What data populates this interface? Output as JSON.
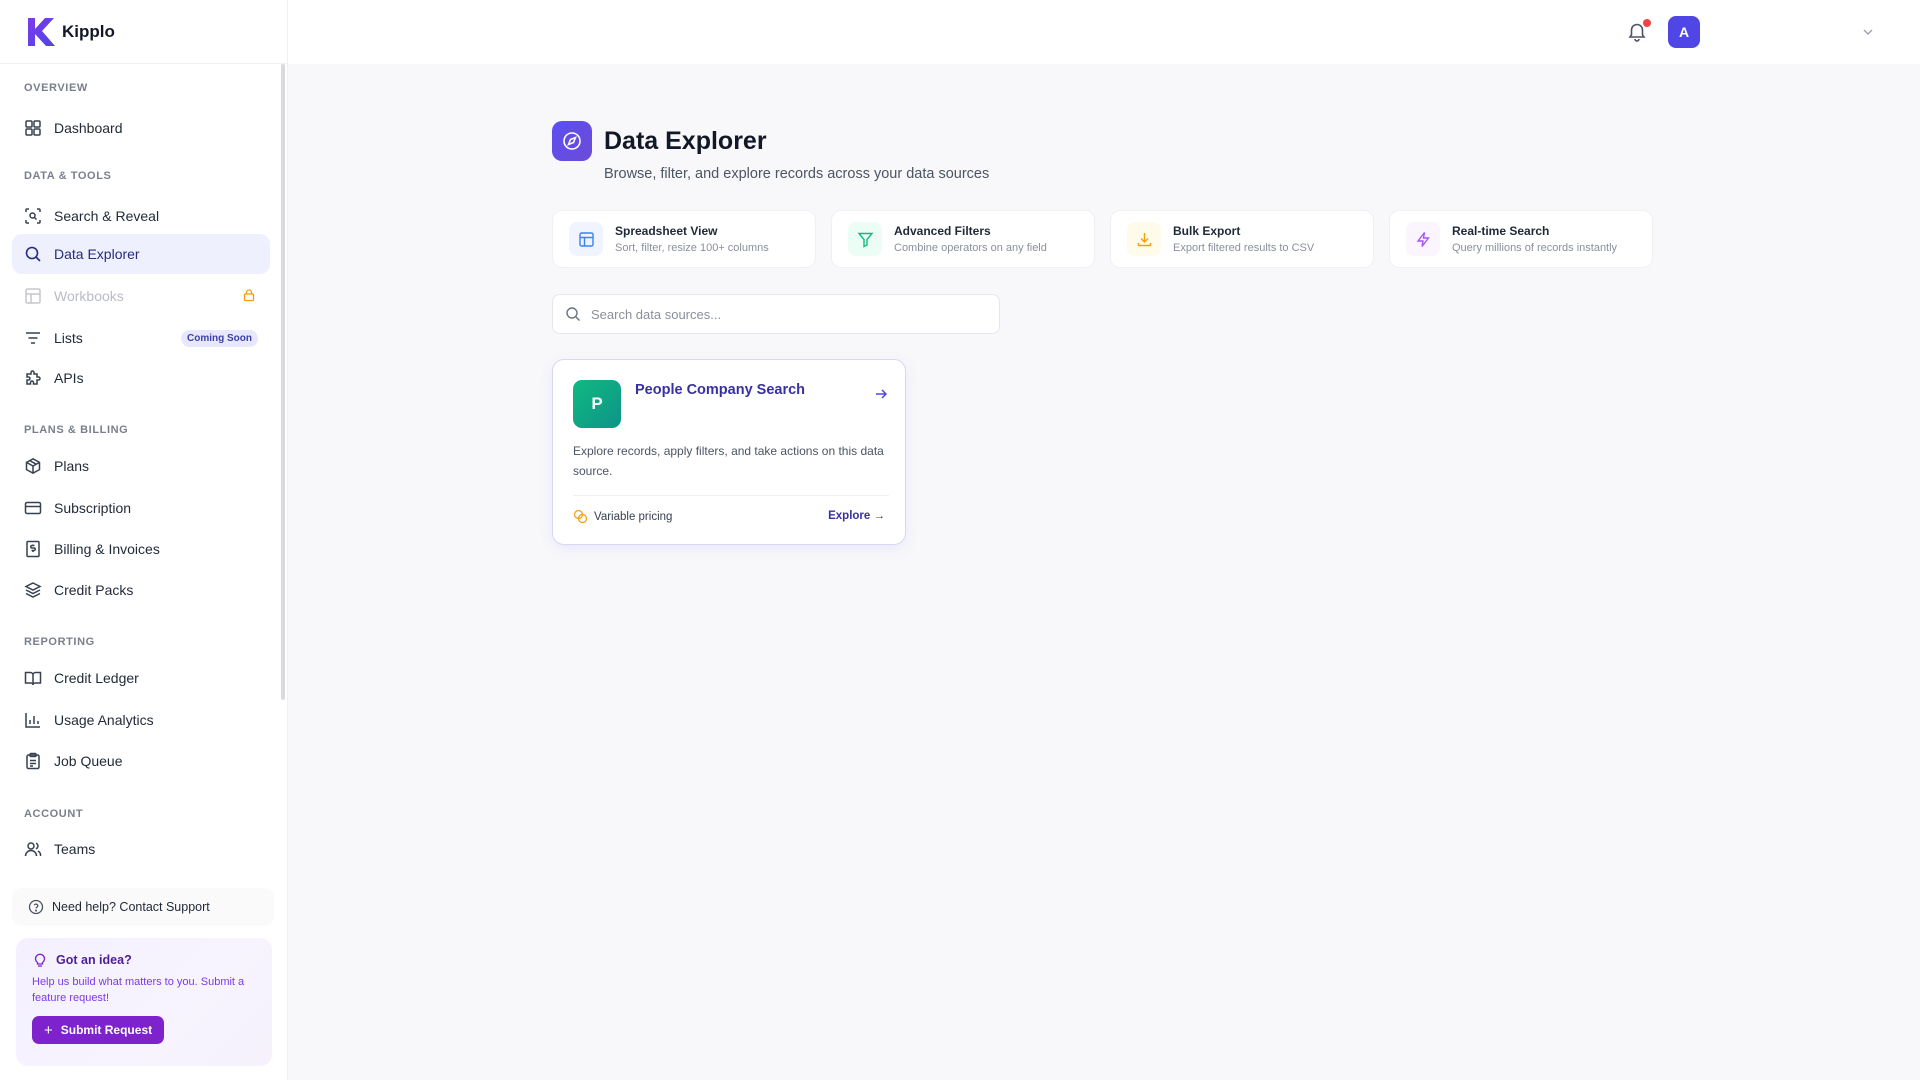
{
  "brand": {
    "name": "Kipplo"
  },
  "sidebar": {
    "sections": {
      "overview": "OVERVIEW",
      "data_tools": "DATA & TOOLS",
      "plans_billing": "PLANS & BILLING",
      "reporting": "REPORTING",
      "account": "ACCOUNT"
    },
    "items": {
      "dashboard": "Dashboard",
      "search_reveal": "Search & Reveal",
      "data_explorer": "Data Explorer",
      "workbooks": "Workbooks",
      "lists": "Lists",
      "lists_badge": "Coming Soon",
      "apis": "APIs",
      "plans": "Plans",
      "subscription": "Subscription",
      "billing": "Billing & Invoices",
      "credit_packs": "Credit Packs",
      "credit_ledger": "Credit Ledger",
      "usage_analytics": "Usage Analytics",
      "job_queue": "Job Queue",
      "teams": "Teams"
    },
    "help": "Need help? Contact Support",
    "idea": {
      "title": "Got an idea?",
      "text": "Help us build what matters to you. Submit a feature request!",
      "button": "Submit Request"
    }
  },
  "topbar": {
    "avatar_letter": "A"
  },
  "page": {
    "title": "Data Explorer",
    "subtitle": "Browse, filter, and explore records across your data sources"
  },
  "features": [
    {
      "title": "Spreadsheet View",
      "desc": "Sort, filter, resize 100+ columns",
      "icon": "table-icon",
      "color": "#3b82f6"
    },
    {
      "title": "Advanced Filters",
      "desc": "Combine operators on any field",
      "icon": "filter-icon",
      "color": "#10b981"
    },
    {
      "title": "Bulk Export",
      "desc": "Export filtered results to CSV",
      "icon": "download-icon",
      "color": "#f59e0b"
    },
    {
      "title": "Real-time Search",
      "desc": "Query millions of records instantly",
      "icon": "bolt-icon",
      "color": "#a855f7"
    }
  ],
  "search": {
    "placeholder": "Search data sources..."
  },
  "sources": [
    {
      "letter": "P",
      "title": "People Company Search",
      "description": "Explore records, apply filters, and take actions on this data source.",
      "pricing": "Variable pricing",
      "action": "Explore →"
    }
  ],
  "colors": {
    "accent": "#4f46e5",
    "active_bg": "#eef0fe",
    "purple": "#7e22ce"
  }
}
